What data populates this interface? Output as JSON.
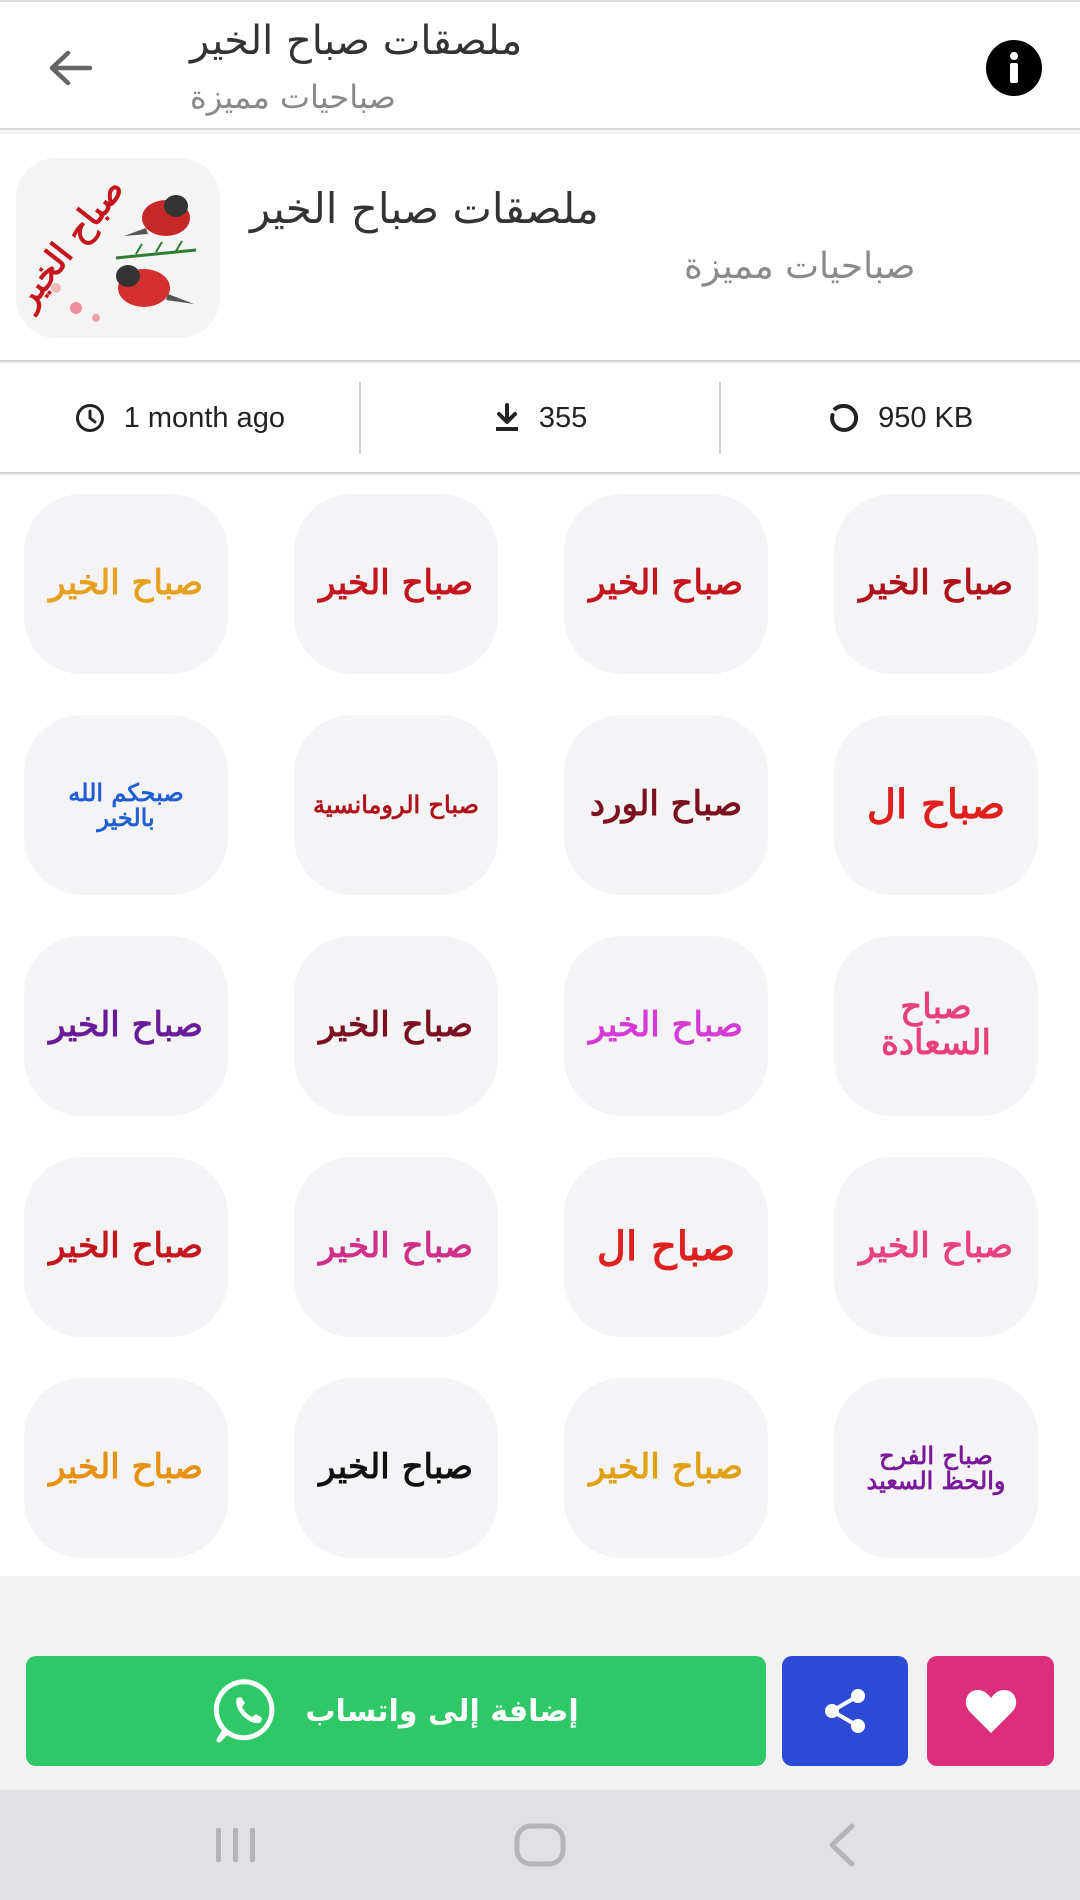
{
  "topbar": {
    "title": "ملصقات صباح الخير",
    "subtitle": "صباحيات مميزة",
    "back_icon": "arrow-left-icon",
    "info_icon": "info-icon"
  },
  "pack": {
    "title": "ملصقات صباح الخير",
    "subtitle": "صباحيات مميزة",
    "thumb_text": "صباح الخير"
  },
  "stats": {
    "updated": "1 month ago",
    "downloads": "355",
    "size": "950 KB"
  },
  "stickers": [
    {
      "text": "صباح الخير",
      "color": "#e8a020"
    },
    {
      "text": "صباح الخير",
      "color": "#c4161c"
    },
    {
      "text": "صباح الخير",
      "color": "#c4161c"
    },
    {
      "text": "صباح الخير",
      "color": "#b0121a"
    },
    {
      "text": "صبحكم الله بالخير",
      "color": "#1f5fd1"
    },
    {
      "text": "صباح الرومانسية",
      "color": "#b0121a"
    },
    {
      "text": "صباح الورد",
      "color": "#7a1020"
    },
    {
      "text": "صباح ال",
      "color": "#e0201f"
    },
    {
      "text": "صباح الخير",
      "color": "#6a1b9a"
    },
    {
      "text": "صباح الخير",
      "color": "#7a1020"
    },
    {
      "text": "صباح الخير",
      "color": "#d63ad6"
    },
    {
      "text": "صباح السعادة",
      "color": "#e8407a"
    },
    {
      "text": "صباح الخير",
      "color": "#c4161c"
    },
    {
      "text": "صباح الخير",
      "color": "#d0308a"
    },
    {
      "text": "صباح ال",
      "color": "#e0201f"
    },
    {
      "text": "صباح الخير",
      "color": "#e84080"
    },
    {
      "text": "صباح الخير",
      "color": "#e89010"
    },
    {
      "text": "صباح الخير",
      "color": "#111111"
    },
    {
      "text": "صباح الخير",
      "color": "#e0a010"
    },
    {
      "text": "صباح الفرح والحظ السعيد",
      "color": "#7a1a9a"
    }
  ],
  "actions": {
    "whatsapp_label": "إضافة إلى واتساب",
    "whatsapp_color": "#2ec866",
    "share_color": "#2b4bd6",
    "favorite_color": "#dc2e7a"
  },
  "navbar": {
    "recent_icon": "recent-apps-icon",
    "home_icon": "home-icon",
    "back_icon": "back-chevron-icon"
  }
}
